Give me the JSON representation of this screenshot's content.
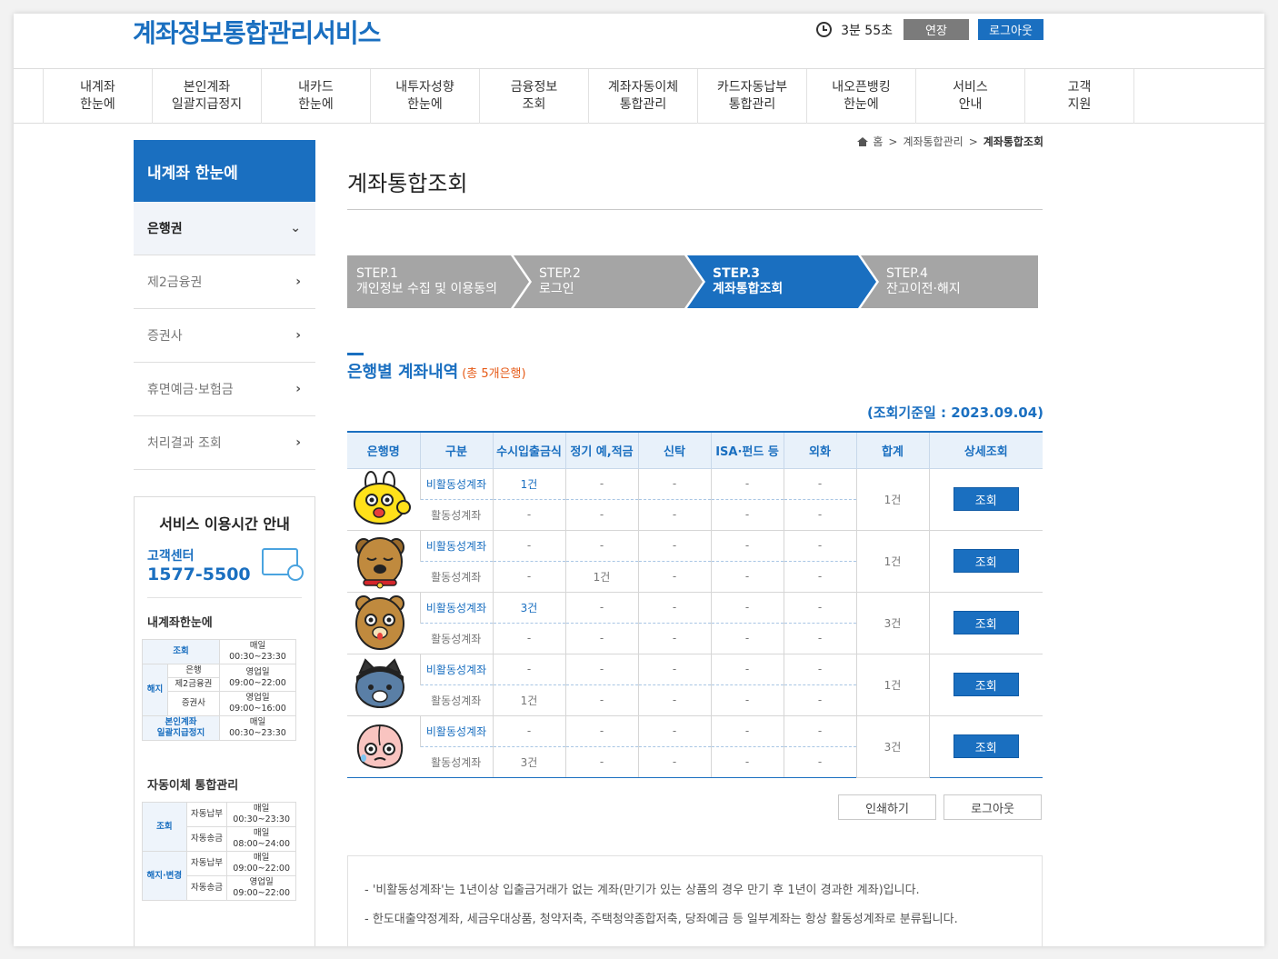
{
  "header": {
    "site_title": "계좌정보통합관리서비스",
    "timer": "3분 55초",
    "extend_label": "연장",
    "logout_label": "로그아웃"
  },
  "gnb": [
    {
      "label": "내계좌\n한눈에"
    },
    {
      "label": "본인계좌\n일괄지급정지"
    },
    {
      "label": "내카드\n한눈에"
    },
    {
      "label": "내투자성향\n한눈에"
    },
    {
      "label": "금융정보\n조회"
    },
    {
      "label": "계좌자동이체\n통합관리"
    },
    {
      "label": "카드자동납부\n통합관리"
    },
    {
      "label": "내오픈뱅킹\n한눈에"
    },
    {
      "label": "서비스\n안내"
    },
    {
      "label": "고객\n지원"
    }
  ],
  "lnb": {
    "title": "내계좌 한눈에",
    "items": [
      {
        "label": "은행권",
        "active": true
      },
      {
        "label": "제2금융권"
      },
      {
        "label": "증권사"
      },
      {
        "label": "휴면예금·보험금"
      },
      {
        "label": "처리결과 조회"
      }
    ]
  },
  "service_box": {
    "title": "서비스 이용시간 안내",
    "cs_label": "고객센터",
    "cs_number": "1577-5500",
    "sub1": "내계좌한눈에",
    "t1": {
      "r1_cat": "조회",
      "r1_time": "매일\n00:30~23:30",
      "r2_cat": "해지",
      "r2_a": "은행",
      "r2_a_time": "영업일\n09:00~22:00",
      "r2_b": "제2금융권",
      "r2_c": "증권사",
      "r2_c_time": "영업일\n09:00~16:00",
      "r3_cat": "본인계좌\n일괄지급정지",
      "r3_time": "매일\n00:30~23:30"
    },
    "sub2": "자동이체 통합관리",
    "t2": {
      "r1_cat": "조회",
      "r1_a": "자동납부",
      "r1_a_time": "매일\n00:30~23:30",
      "r1_b": "자동송금",
      "r1_b_time": "매일\n08:00~24:00",
      "r2_cat": "해지·변경",
      "r2_a": "자동납부",
      "r2_a_time": "매일\n09:00~22:00",
      "r2_b": "자동송금",
      "r2_b_time": "영업일\n09:00~22:00"
    }
  },
  "breadcrumb": {
    "home": "홈",
    "sep": ">",
    "level1": "계좌통합관리",
    "current": "계좌통합조회"
  },
  "page_title": "계좌통합조회",
  "steps": [
    {
      "label": "STEP.1\n개인정보 수집 및 이용동의"
    },
    {
      "label": "STEP.2\n로그인"
    },
    {
      "label": "STEP.3\n계좌통합조회"
    },
    {
      "label": "STEP.4\n잔고이전·해지"
    }
  ],
  "section": {
    "title": "은행별 계좌내역",
    "count": "(총 5개은행)",
    "query_date": "(조회기준일 : 2023.09.04)"
  },
  "table": {
    "headers": [
      "은행명",
      "구분",
      "수시입출금식",
      "정기 예,적금",
      "신탁",
      "ISA·펀드 등",
      "외화",
      "합계",
      "상세조회"
    ],
    "inactive_label": "비활동성계좌",
    "active_label": "활동성계좌",
    "view_label": "조회",
    "banks": [
      {
        "logo": "muzi-icon",
        "inactive": [
          "1건",
          "-",
          "-",
          "-",
          "-"
        ],
        "active": [
          "-",
          "-",
          "-",
          "-",
          "-"
        ],
        "total": "1건"
      },
      {
        "logo": "frodo-icon",
        "inactive": [
          "-",
          "-",
          "-",
          "-",
          "-"
        ],
        "active": [
          "-",
          "1건",
          "-",
          "-",
          "-"
        ],
        "total": "1건"
      },
      {
        "logo": "ryan-bear-icon",
        "inactive": [
          "3건",
          "-",
          "-",
          "-",
          "-"
        ],
        "active": [
          "-",
          "-",
          "-",
          "-",
          "-"
        ],
        "total": "3건"
      },
      {
        "logo": "neo-icon",
        "inactive": [
          "-",
          "-",
          "-",
          "-",
          "-"
        ],
        "active": [
          "1건",
          "-",
          "-",
          "-",
          "-"
        ],
        "total": "1건"
      },
      {
        "logo": "apeach-icon",
        "inactive": [
          "-",
          "-",
          "-",
          "-",
          "-"
        ],
        "active": [
          "3건",
          "-",
          "-",
          "-",
          "-"
        ],
        "total": "3건"
      }
    ]
  },
  "buttons": {
    "print": "인쇄하기",
    "logout": "로그아웃"
  },
  "notice": [
    "- '비활동성계좌'는 1년이상 입출금거래가 없는 계좌(만기가 있는 상품의 경우 만기 후 1년이 경과한 계좌)입니다.",
    "- 한도대출약정계좌, 세금우대상품, 청약저축, 주택청약종합저축, 당좌예금 등 일부계좌는 항상 활동성계좌로 분류됩니다."
  ]
}
